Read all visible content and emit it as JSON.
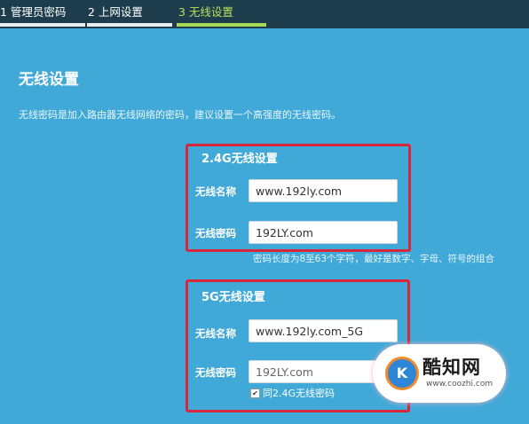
{
  "tabs": [
    {
      "label": "1 管理员密码"
    },
    {
      "label": "2 上网设置"
    },
    {
      "label": "3 无线设置"
    }
  ],
  "page": {
    "title": "无线设置",
    "intro": "无线密码是加入路由器无线网络的密码，建议设置一个高强度的无线密码。"
  },
  "wifi24": {
    "title": "2.4G无线设置",
    "name_label": "无线名称",
    "name_value": "www.192ly.com",
    "password_label": "无线密码",
    "password_value": "192LY.com",
    "hint": "密码长度为8至63个字符，最好是数字、字母、符号的组合"
  },
  "wifi5": {
    "title": "5G无线设置",
    "name_label": "无线名称",
    "name_value": "www.192ly.com_5G",
    "password_label": "无线密码",
    "password_value": "192LY.com",
    "same_password_label": "同2.4G无线密码",
    "same_password_checked": true
  },
  "watermark": {
    "name": "酷知网",
    "url": "www.coozhi.com"
  },
  "colors": {
    "background": "#40a9d8",
    "tab_bar": "#1d3d4d",
    "active_tab": "#a7d957",
    "highlight_box": "#d8263a"
  }
}
